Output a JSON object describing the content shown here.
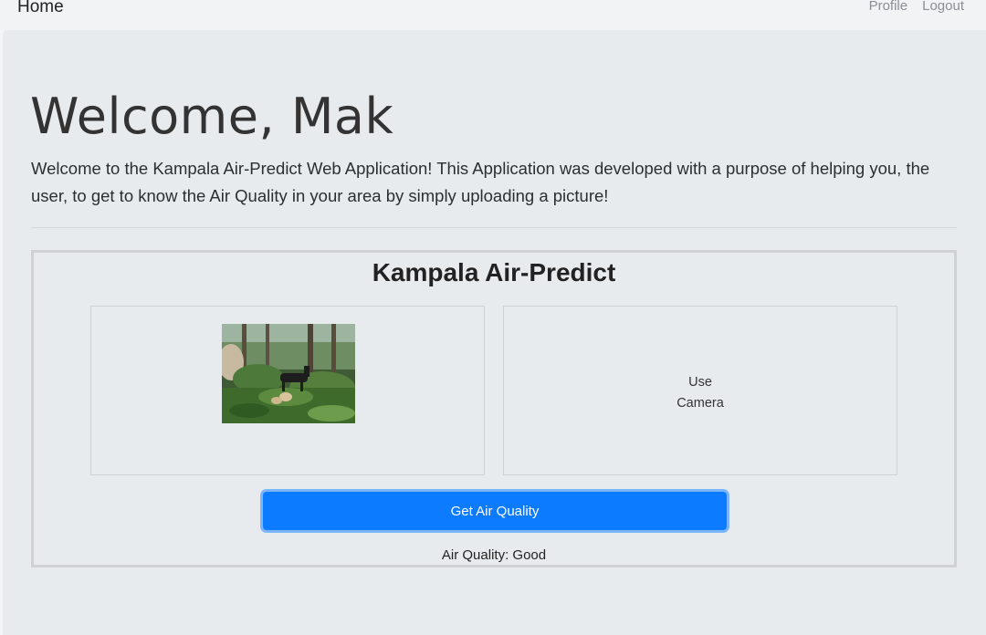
{
  "nav": {
    "brand": "Home",
    "links": [
      "Profile",
      "Logout"
    ]
  },
  "hero": {
    "title": "Welcome, Mak",
    "lead": "Welcome to the Kampala Air-Predict Web Application! This Application was developed with a purpose of helping you, the user, to get to know the Air Quality in your area by simply uploading a picture!"
  },
  "predictor": {
    "title": "Kampala Air-Predict",
    "camera_line1": "Use",
    "camera_line2": "Camera",
    "button_label": "Get Air Quality",
    "result": "Air Quality: Good"
  },
  "colors": {
    "primary": "#0d7bff",
    "page_bg": "#e8ebee"
  }
}
